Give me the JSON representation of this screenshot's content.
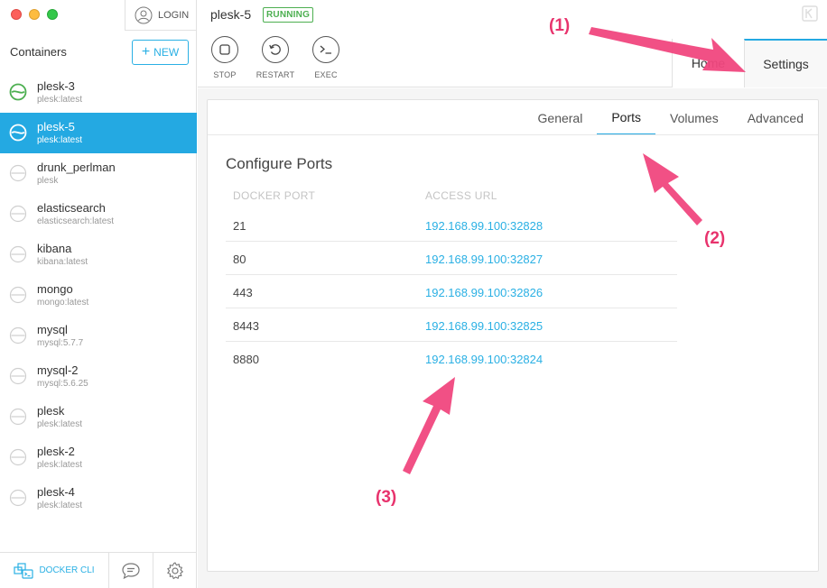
{
  "sidebar": {
    "login_label": "LOGIN",
    "containers_title": "Containers",
    "new_label": "NEW",
    "items": [
      {
        "name": "plesk-3",
        "image": "plesk:latest",
        "status": "running"
      },
      {
        "name": "plesk-5",
        "image": "plesk:latest",
        "status": "running"
      },
      {
        "name": "drunk_perlman",
        "image": "plesk",
        "status": "stopped"
      },
      {
        "name": "elasticsearch",
        "image": "elasticsearch:latest",
        "status": "stopped"
      },
      {
        "name": "kibana",
        "image": "kibana:latest",
        "status": "stopped"
      },
      {
        "name": "mongo",
        "image": "mongo:latest",
        "status": "stopped"
      },
      {
        "name": "mysql",
        "image": "mysql:5.7.7",
        "status": "stopped"
      },
      {
        "name": "mysql-2",
        "image": "mysql:5.6.25",
        "status": "stopped"
      },
      {
        "name": "plesk",
        "image": "plesk:latest",
        "status": "stopped"
      },
      {
        "name": "plesk-2",
        "image": "plesk:latest",
        "status": "stopped"
      },
      {
        "name": "plesk-4",
        "image": "plesk:latest",
        "status": "stopped"
      }
    ],
    "active_item": "plesk-5",
    "footer": {
      "docker_cli_label": "DOCKER CLI"
    }
  },
  "header": {
    "container_name": "plesk-5",
    "status_badge": "RUNNING",
    "actions": [
      {
        "label": "STOP",
        "icon": "stop-icon"
      },
      {
        "label": "RESTART",
        "icon": "restart-icon"
      },
      {
        "label": "EXEC",
        "icon": "terminal-icon"
      }
    ],
    "top_tabs": [
      {
        "label": "Home",
        "active": false
      },
      {
        "label": "Settings",
        "active": true
      }
    ]
  },
  "settings": {
    "sub_tabs": [
      {
        "label": "General",
        "active": false
      },
      {
        "label": "Ports",
        "active": true
      },
      {
        "label": "Volumes",
        "active": false
      },
      {
        "label": "Advanced",
        "active": false
      }
    ],
    "section_title": "Configure Ports",
    "columns": [
      "DOCKER PORT",
      "ACCESS URL"
    ],
    "ports": [
      {
        "docker_port": "21",
        "access_url": "192.168.99.100:32828"
      },
      {
        "docker_port": "80",
        "access_url": "192.168.99.100:32827"
      },
      {
        "docker_port": "443",
        "access_url": "192.168.99.100:32826"
      },
      {
        "docker_port": "8443",
        "access_url": "192.168.99.100:32825"
      },
      {
        "docker_port": "8880",
        "access_url": "192.168.99.100:32824"
      }
    ]
  },
  "annotations": [
    "(1)",
    "(2)",
    "(3)"
  ],
  "colors": {
    "accent": "#24a9e2",
    "running": "#4caf50",
    "annotation": "#e8336d"
  }
}
